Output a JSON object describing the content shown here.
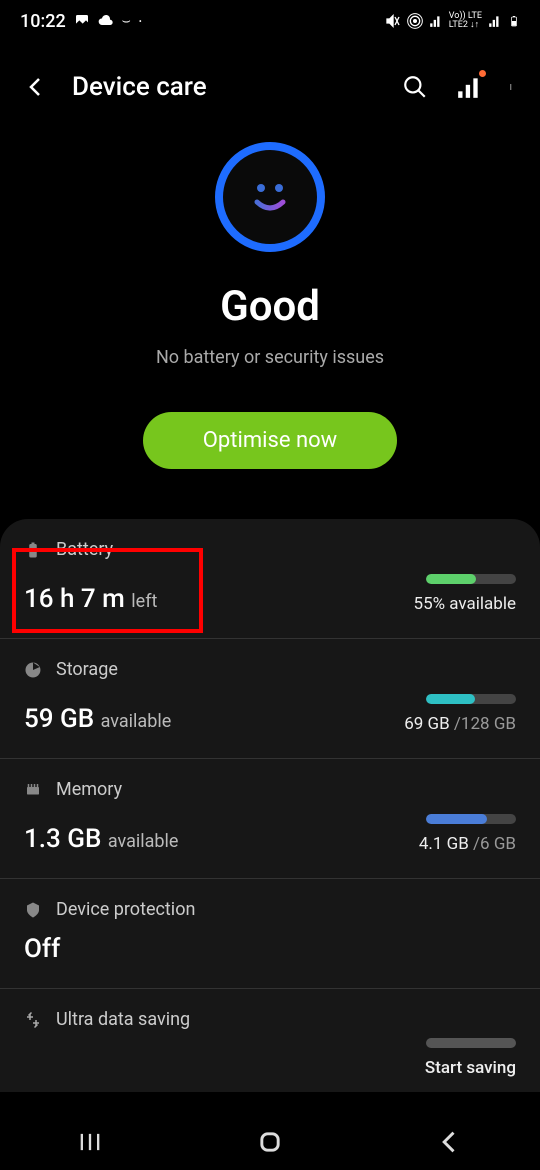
{
  "status_bar": {
    "time": "10:22",
    "indicators": "LTE"
  },
  "header": {
    "title": "Device care"
  },
  "status_section": {
    "title": "Good",
    "subtitle": "No battery or security issues",
    "button": "Optimise now"
  },
  "battery": {
    "label": "Battery",
    "main_value": "16 h 7 m",
    "main_suffix": "left",
    "right_text": "55% available",
    "progress": 55,
    "color": "#5dd06b"
  },
  "storage": {
    "label": "Storage",
    "main_value": "59 GB",
    "main_suffix": "available",
    "right_value": "69 GB",
    "right_total": "/128 GB",
    "progress": 54,
    "color": "#2ec0c4"
  },
  "memory": {
    "label": "Memory",
    "main_value": "1.3 GB",
    "main_suffix": "available",
    "right_value": "4.1 GB",
    "right_total": "/6 GB",
    "progress": 68,
    "color": "#4a7dd8"
  },
  "protection": {
    "label": "Device protection",
    "main_value": "Off"
  },
  "ultra_data": {
    "label": "Ultra data saving",
    "right_text": "Start saving"
  }
}
